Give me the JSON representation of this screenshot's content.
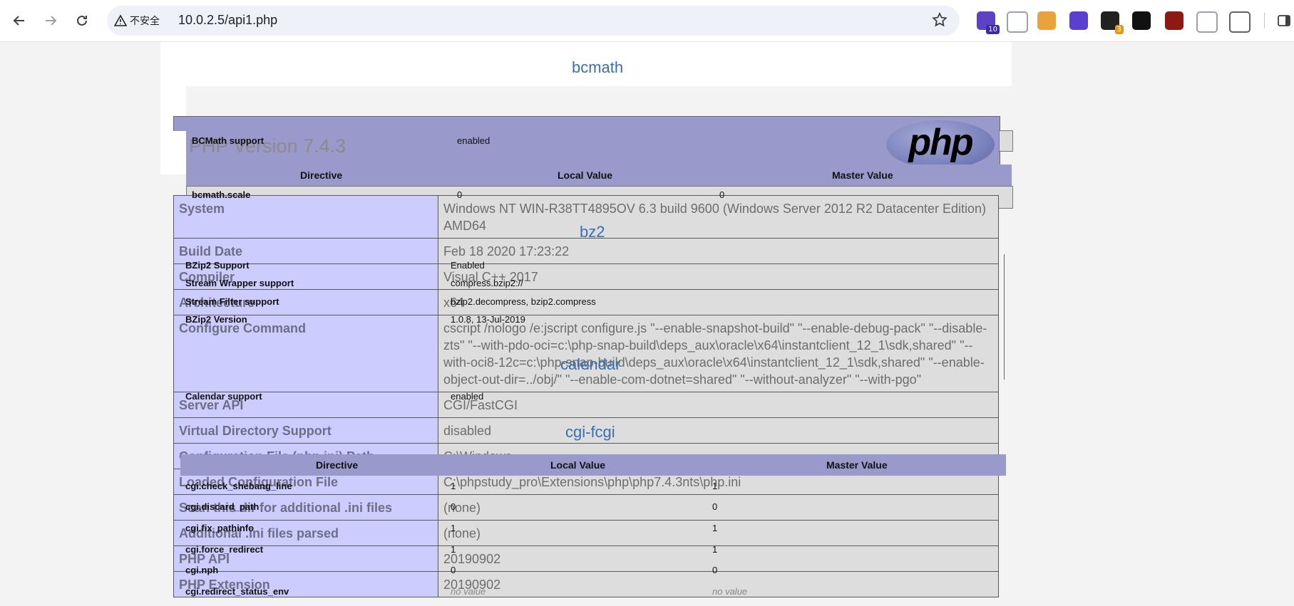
{
  "browser": {
    "security_label": "不安全",
    "url": "10.0.2.5/api1.php",
    "extensions": [
      {
        "icon": "extension-house-icon",
        "color": "#5b43c4",
        "badge": "10",
        "badge_color": "#3b2ba0"
      },
      {
        "icon": "extension-link-icon",
        "color": "#9aa0a6",
        "badge": ""
      },
      {
        "icon": "extension-pilcrow-icon",
        "color": "#e8a33a",
        "badge": ""
      },
      {
        "icon": "extension-orb-icon",
        "color": "#5a3fd0",
        "badge": ""
      },
      {
        "icon": "extension-q-icon",
        "color": "#222222",
        "badge": "3",
        "badge_color": "#e09a1a"
      },
      {
        "icon": "extension-glasses-icon",
        "color": "#111111",
        "badge": ""
      },
      {
        "icon": "extension-owl-icon",
        "color": "#8a1a12",
        "badge": ""
      },
      {
        "icon": "extension-gitzip-icon",
        "color": "#9aa0a6",
        "badge": ""
      },
      {
        "icon": "extensions-puzzle-icon",
        "color": "#5f6368",
        "badge": ""
      }
    ]
  },
  "php": {
    "title": "PHP Version 7.4.3",
    "logo_text": "php",
    "rows": [
      {
        "key": "System",
        "value": "Windows NT WIN-R38TT4895OV 6.3 build 9600 (Windows Server 2012 R2 Datacenter Edition) AMD64"
      },
      {
        "key": "Build Date",
        "value": "Feb 18 2020 17:23:22"
      },
      {
        "key": "Compiler",
        "value": "Visual C++ 2017"
      },
      {
        "key": "Architecture",
        "value": "x64"
      },
      {
        "key": "Configure Command",
        "value": "cscript /nologo /e:jscript configure.js \"--enable-snapshot-build\" \"--enable-debug-pack\" \"--disable-zts\" \"--with-pdo-oci=c:\\php-snap-build\\deps_aux\\oracle\\x64\\instantclient_12_1\\sdk,shared\" \"--with-oci8-12c=c:\\php-snap-build\\deps_aux\\oracle\\x64\\instantclient_12_1\\sdk,shared\" \"--enable-object-out-dir=../obj/\" \"--enable-com-dotnet=shared\" \"--without-analyzer\" \"--with-pgo\""
      },
      {
        "key": "Server API",
        "value": "CGI/FastCGI"
      },
      {
        "key": "Virtual Directory Support",
        "value": "disabled"
      },
      {
        "key": "Configuration File (php.ini) Path",
        "value": "C:\\Windows"
      },
      {
        "key": "Loaded Configuration File",
        "value": "C:\\phpstudy_pro\\Extensions\\php\\php7.4.3nts\\php.ini"
      },
      {
        "key": "Scan this dir for additional .ini files",
        "value": "(none)"
      },
      {
        "key": "Additional .ini files parsed",
        "value": "(none)"
      },
      {
        "key": "PHP API",
        "value": "20190902"
      },
      {
        "key": "PHP Extension",
        "value": "20190902"
      }
    ]
  },
  "bcmath": {
    "heading": "bcmath",
    "support_key": "BCMath support",
    "support_value": "enabled",
    "head": [
      "Directive",
      "Local Value",
      "Master Value"
    ],
    "scale_key": "bcmath.scale",
    "scale_local": "0",
    "scale_master": "0"
  },
  "bz2": {
    "heading": "bz2",
    "rows": [
      {
        "key": "BZip2 Support",
        "value": "Enabled"
      },
      {
        "key": "Stream Wrapper support",
        "value": "compress.bzip2://"
      },
      {
        "key": "Stream Filter support",
        "value": "bzip2.decompress, bzip2.compress"
      },
      {
        "key": "BZip2 Version",
        "value": "1.0.8, 13-Jul-2019"
      }
    ]
  },
  "calendar": {
    "heading": "calendar",
    "key": "Calendar support",
    "value": "enabled"
  },
  "cgi": {
    "heading": "cgi-fcgi",
    "head": [
      "Directive",
      "Local Value",
      "Master Value"
    ],
    "rows": [
      {
        "key": "cgi.check_shebang_line",
        "local": "1",
        "master": "1"
      },
      {
        "key": "cgi.discard_path",
        "local": "0",
        "master": "0"
      },
      {
        "key": "cgi.fix_pathinfo",
        "local": "1",
        "master": "1"
      },
      {
        "key": "cgi.force_redirect",
        "local": "1",
        "master": "1"
      },
      {
        "key": "cgi.nph",
        "local": "0",
        "master": "0"
      },
      {
        "key": "cgi.redirect_status_env",
        "local": "no value",
        "master": "no value"
      }
    ]
  }
}
